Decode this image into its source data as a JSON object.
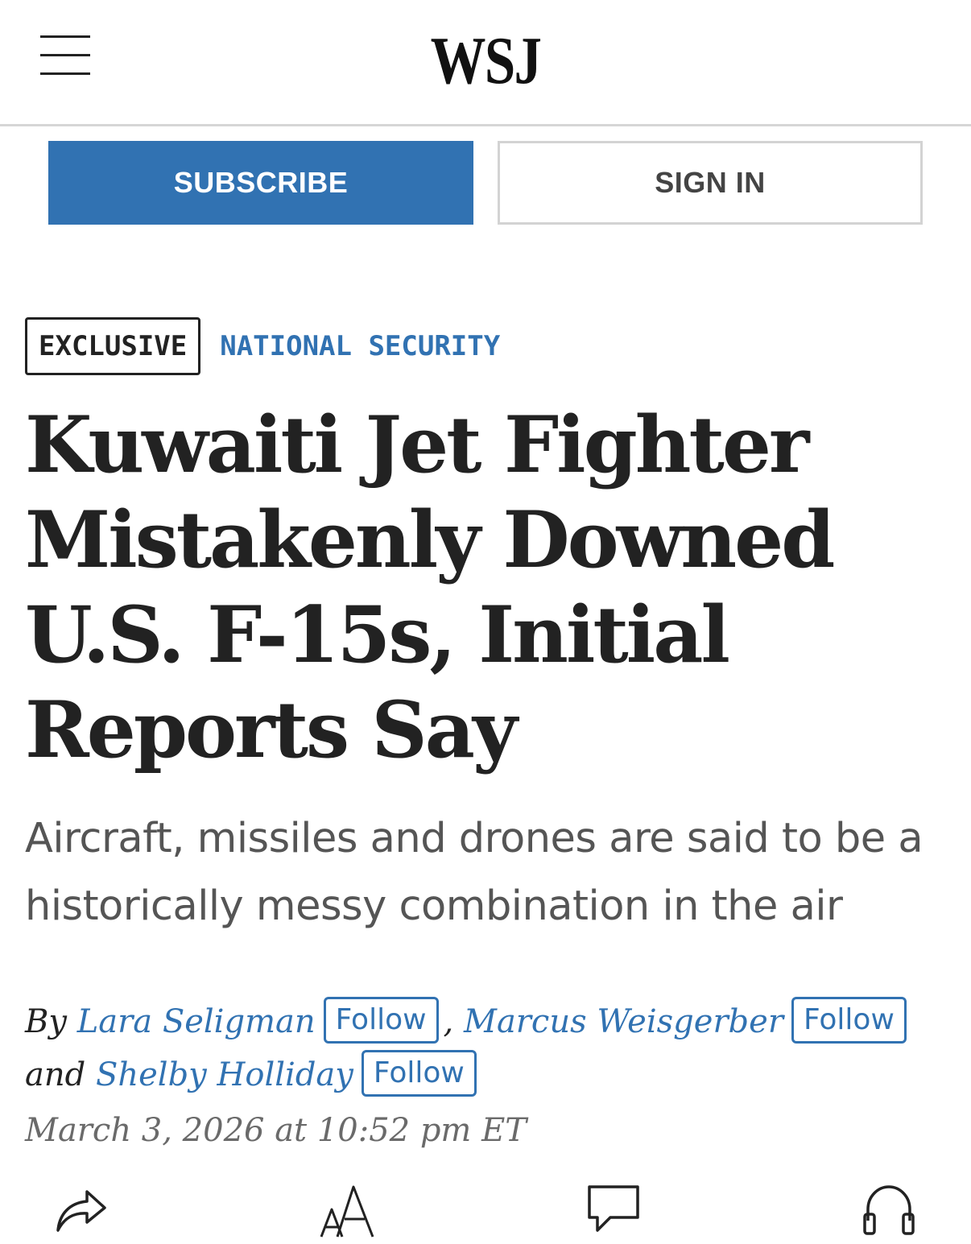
{
  "header": {
    "logo": "WSJ",
    "menu_icon": "hamburger-menu-icon"
  },
  "account": {
    "subscribe_label": "SUBSCRIBE",
    "signin_label": "SIGN IN",
    "accent_color": "#3172b2"
  },
  "article": {
    "flag": "EXCLUSIVE",
    "section": "NATIONAL SECURITY",
    "headline": "Kuwaiti Jet Fighter Mistakenly Downed U.S. F-15s, Initial Reports Say",
    "dek": "Aircraft, missiles and drones are said to be a historically messy combination in the air",
    "byline": {
      "by": "By",
      "separator": ",",
      "and": "and",
      "authors": [
        {
          "name": "Lara Seligman",
          "follow_label": "Follow"
        },
        {
          "name": "Marcus Weisgerber",
          "follow_label": "Follow"
        },
        {
          "name": "Shelby Holliday",
          "follow_label": "Follow"
        }
      ]
    },
    "timestamp": "March 3, 2026 at 10:52 pm ET"
  },
  "toolbar": {
    "icons": [
      "share-icon",
      "text-size-icon",
      "comment-icon",
      "listen-audio-icon"
    ]
  }
}
